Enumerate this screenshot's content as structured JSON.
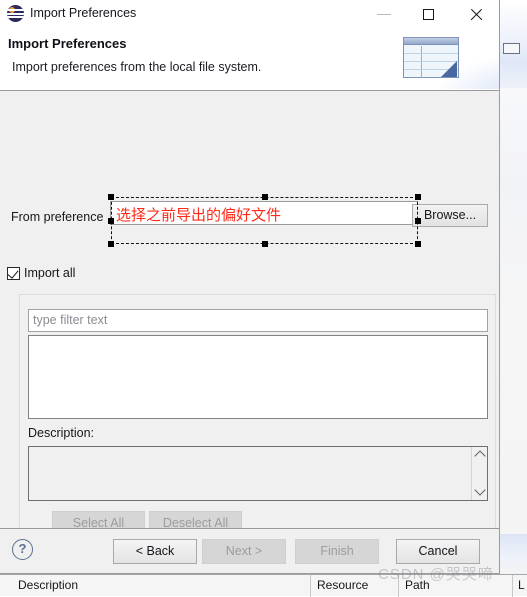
{
  "window": {
    "title": "Import Preferences",
    "app_icon": "eclipse-icon",
    "controls": {
      "minimize": "minimize-icon",
      "maximize": "maximize-icon",
      "close": "close-icon"
    }
  },
  "banner": {
    "title": "Import Preferences",
    "subtitle": "Import preferences from the local file system.",
    "art": "preferences-table-icon"
  },
  "form": {
    "from_preference_label": "From preference",
    "from_preference_value": "",
    "browse_label": "Browse...",
    "import_all_label": "Import all",
    "import_all_checked": true
  },
  "annotation": {
    "text": "选择之前导出的偏好文件",
    "color": "#ff2a18",
    "selected": true
  },
  "group": {
    "filter_placeholder": "type filter text",
    "filter_value": "",
    "tree_items": [],
    "description_label": "Description:",
    "description_value": "",
    "select_all_label": "Select All",
    "deselect_all_label": "Deselect All",
    "select_all_enabled": false,
    "deselect_all_enabled": false
  },
  "footer": {
    "help_glyph": "?",
    "buttons": [
      {
        "label": "< Back",
        "enabled": true
      },
      {
        "label": "Next >",
        "enabled": false
      },
      {
        "label": "Finish",
        "enabled": false
      },
      {
        "label": "Cancel",
        "enabled": true
      }
    ]
  },
  "background": {
    "problems_columns": [
      "Description",
      "Resource",
      "Path",
      "L"
    ],
    "minimize_icon": "minimize-icon"
  },
  "watermark": {
    "text": "CSDN @哭哭啼"
  }
}
